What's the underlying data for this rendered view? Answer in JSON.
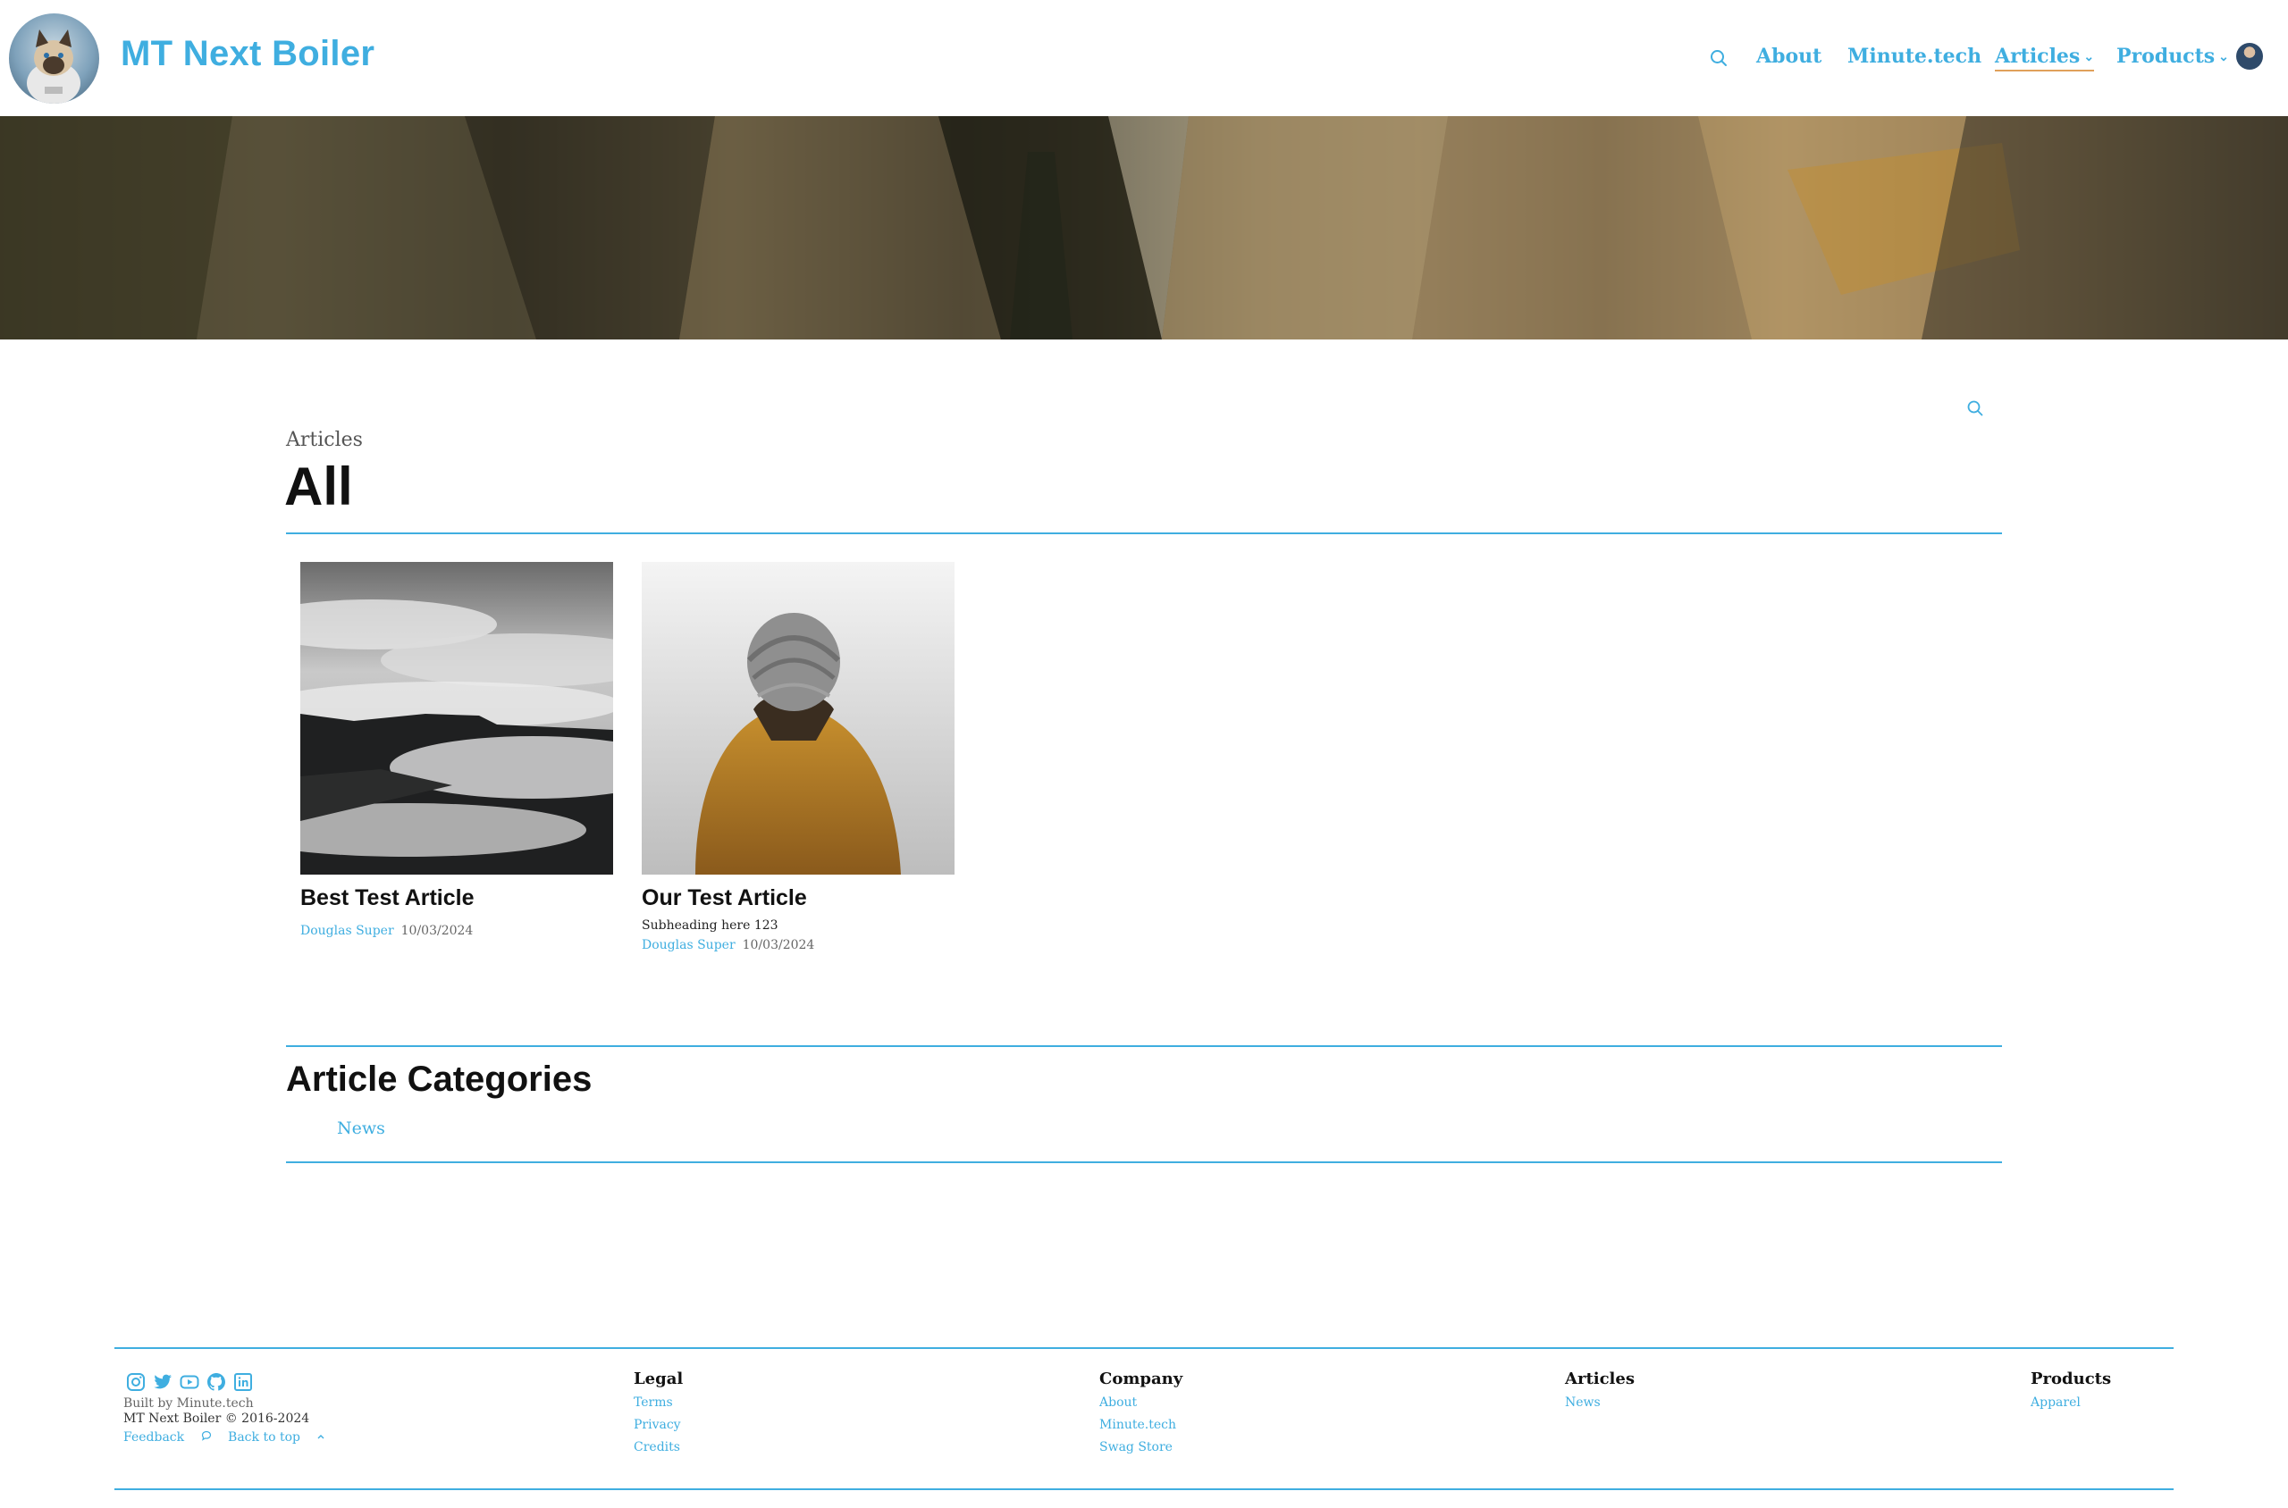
{
  "header": {
    "site_title": "MT Next Boiler",
    "nav": [
      {
        "label": "About"
      },
      {
        "label": "Minute.tech"
      },
      {
        "label": "Articles",
        "active": true,
        "dropdown": true
      },
      {
        "label": "Products",
        "dropdown": true
      }
    ],
    "chevron": "⌄"
  },
  "main": {
    "breadcrumb": "Articles",
    "title": "All",
    "articles": [
      {
        "title": "Best Test Article",
        "subheading": "",
        "author": "Douglas Super",
        "date": "10/03/2024"
      },
      {
        "title": "Our Test Article",
        "subheading": "Subheading here 123",
        "author": "Douglas Super",
        "date": "10/03/2024"
      }
    ],
    "categories_title": "Article Categories",
    "categories": [
      "News"
    ]
  },
  "footer": {
    "built_by": "Built by Minute.tech",
    "copyright": "MT Next Boiler © 2016-2024",
    "feedback": "Feedback",
    "back_to_top": "Back to top",
    "columns": [
      {
        "title": "Legal",
        "links": [
          "Terms",
          "Privacy",
          "Credits"
        ]
      },
      {
        "title": "Company",
        "links": [
          "About",
          "Minute.tech",
          "Swag Store"
        ]
      },
      {
        "title": "Articles",
        "links": [
          "News"
        ]
      },
      {
        "title": "Products",
        "links": [
          "Apparel"
        ]
      }
    ]
  },
  "colors": {
    "accent": "#3faee0",
    "text": "#111111",
    "muted": "#666666"
  },
  "icons": [
    "search-icon",
    "chevron-down-icon",
    "instagram-icon",
    "twitter-icon",
    "youtube-icon",
    "github-icon",
    "linkedin-icon",
    "chat-icon",
    "chevron-up-icon"
  ]
}
